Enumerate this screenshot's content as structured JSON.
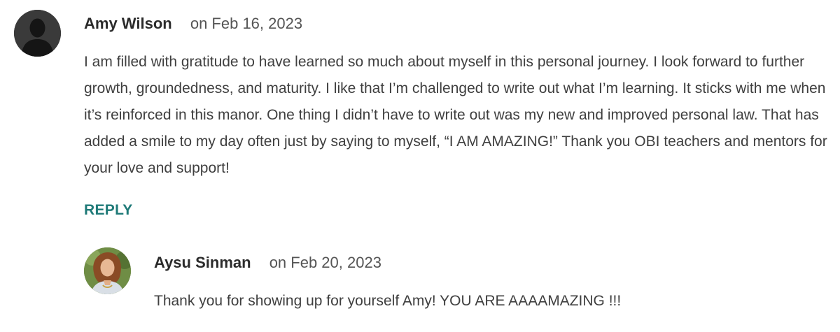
{
  "comments": [
    {
      "author": "Amy Wilson",
      "date": "on Feb 16, 2023",
      "avatar": "default-user-silhouette",
      "text": "I am filled with gratitude to have learned so much about myself in this personal journey. I look forward to further growth, groundedness, and maturity. I like that I’m challenged to write out what I’m learning. It sticks with me when it’s reinforced in this manor. One thing I didn’t have to write out was my new and improved personal law. That has added a smile to my day often just by saying to myself, “I AM AMAZING!” Thank you OBI teachers and mentors for your love and support!",
      "reply_label": "REPLY"
    },
    {
      "author": "Aysu Sinman",
      "date": "on Feb 20, 2023",
      "avatar": "user-photo",
      "text": "Thank you for showing up for yourself Amy! YOU ARE AAAAMAZING !!!"
    }
  ],
  "colors": {
    "reply_link": "#1f7a78",
    "avatar_default_bg": "#3a3a3a"
  }
}
